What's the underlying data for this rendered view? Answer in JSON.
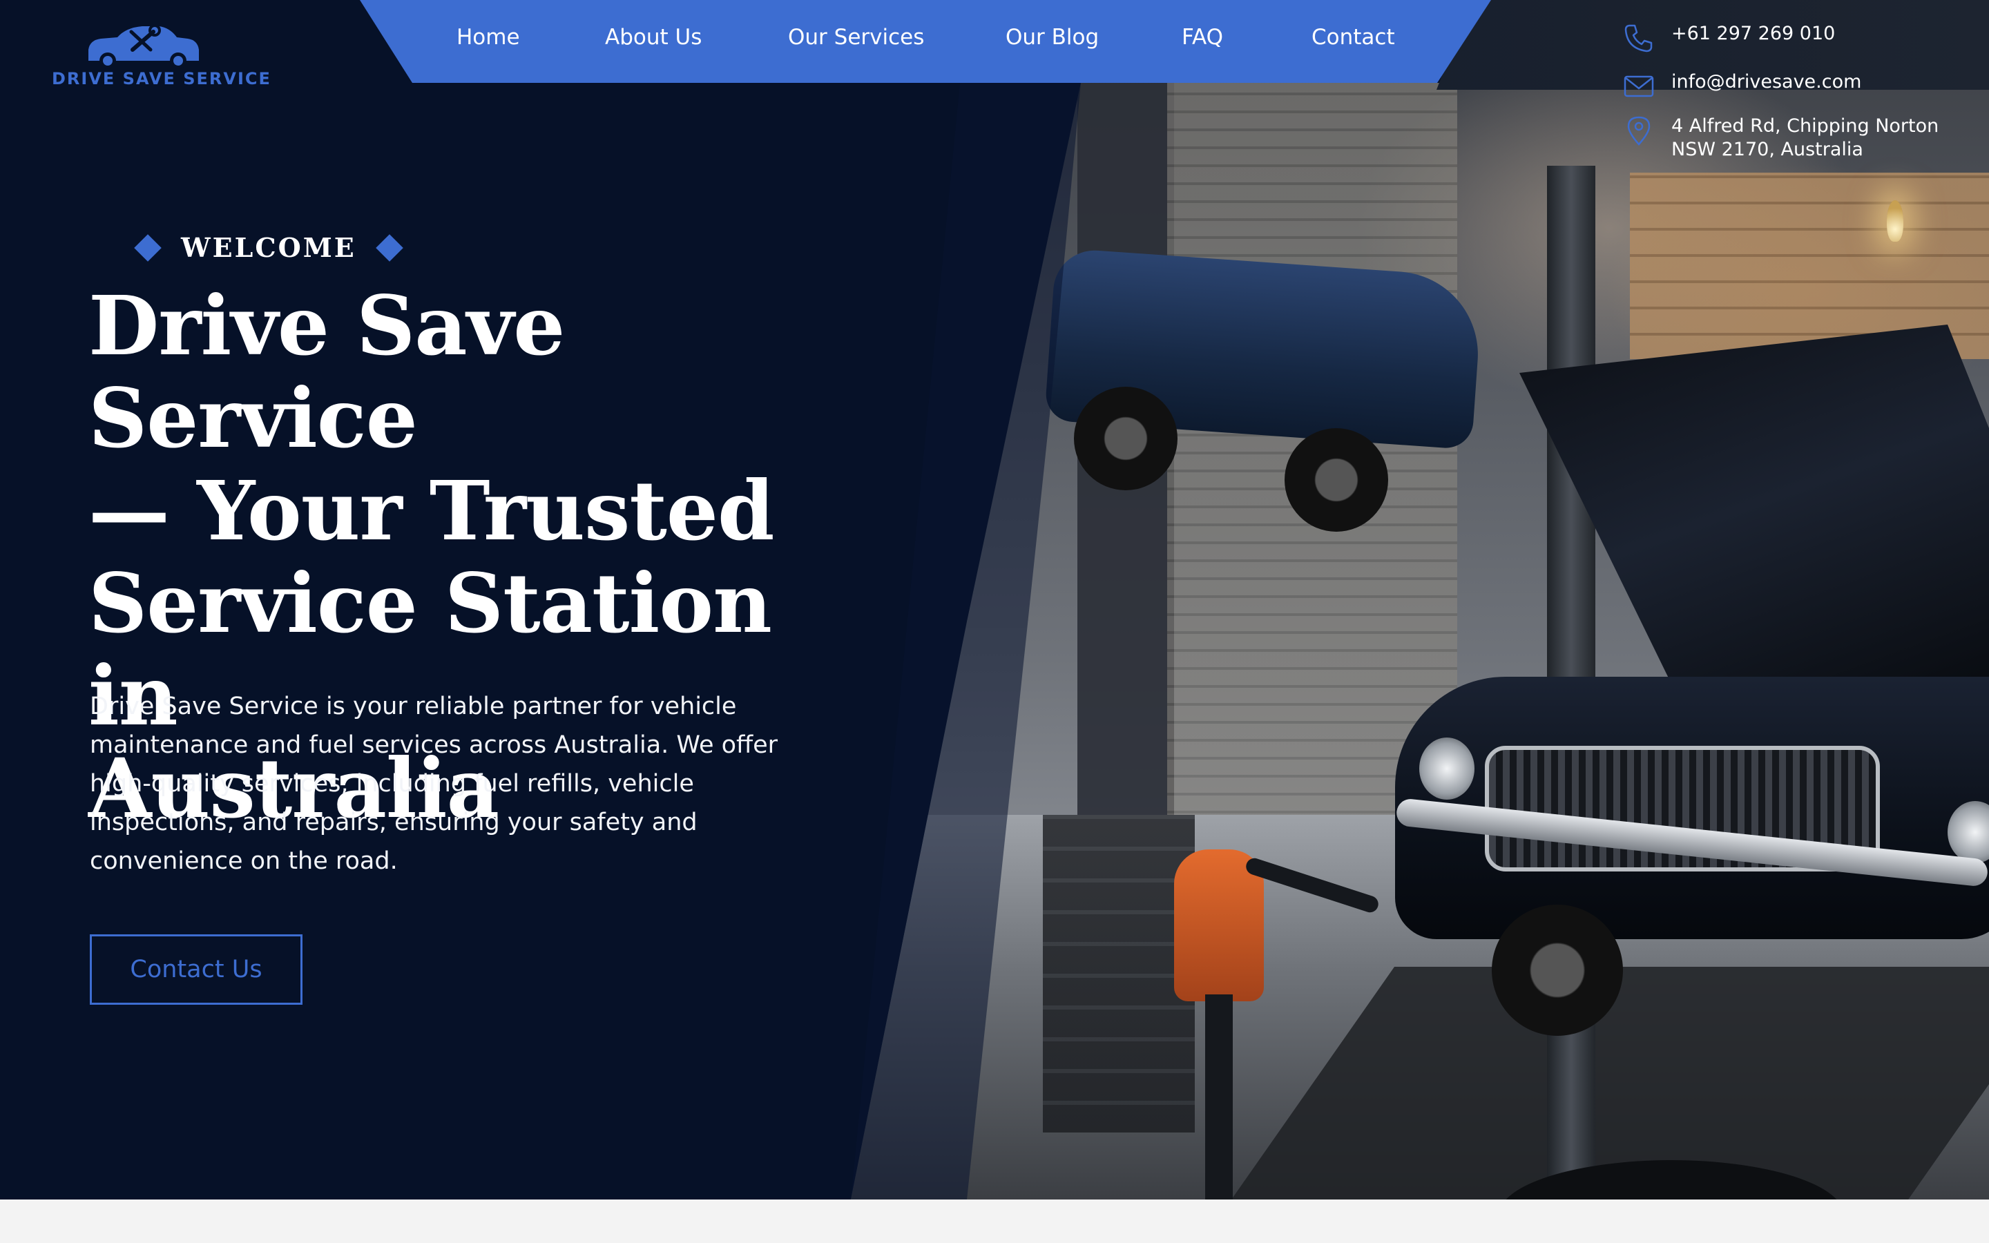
{
  "brand": {
    "name": "DRIVE SAVE SERVICE",
    "accent": "#3d6dd1",
    "background": "#061128"
  },
  "nav": {
    "items": [
      {
        "label": "Home"
      },
      {
        "label": "About Us"
      },
      {
        "label": "Our Services"
      },
      {
        "label": "Our Blog"
      },
      {
        "label": "FAQ"
      },
      {
        "label": "Contact"
      }
    ]
  },
  "contact": {
    "phone": "+61 297 269 010",
    "email": "info@drivesave.com",
    "address_line1": "4 Alfred Rd, Chipping Norton",
    "address_line2": "NSW 2170, Australia",
    "icons": [
      "phone-icon",
      "mail-icon",
      "location-pin-icon"
    ]
  },
  "hero": {
    "eyebrow": "WELCOME",
    "headline_line1": "Drive Save Service",
    "headline_line2": "— Your Trusted",
    "headline_line3": "Service Station in",
    "headline_line4": "Australia",
    "description_line1": "Drive Save Service is your reliable partner for vehicle",
    "description_line2": "maintenance and fuel services across Australia. We offer",
    "description_line3": "high-quality services, including fuel refills, vehicle",
    "description_line4": "inspections, and repairs, ensuring your safety and",
    "description_line5": "convenience on the road.",
    "cta_label": "Contact Us"
  }
}
